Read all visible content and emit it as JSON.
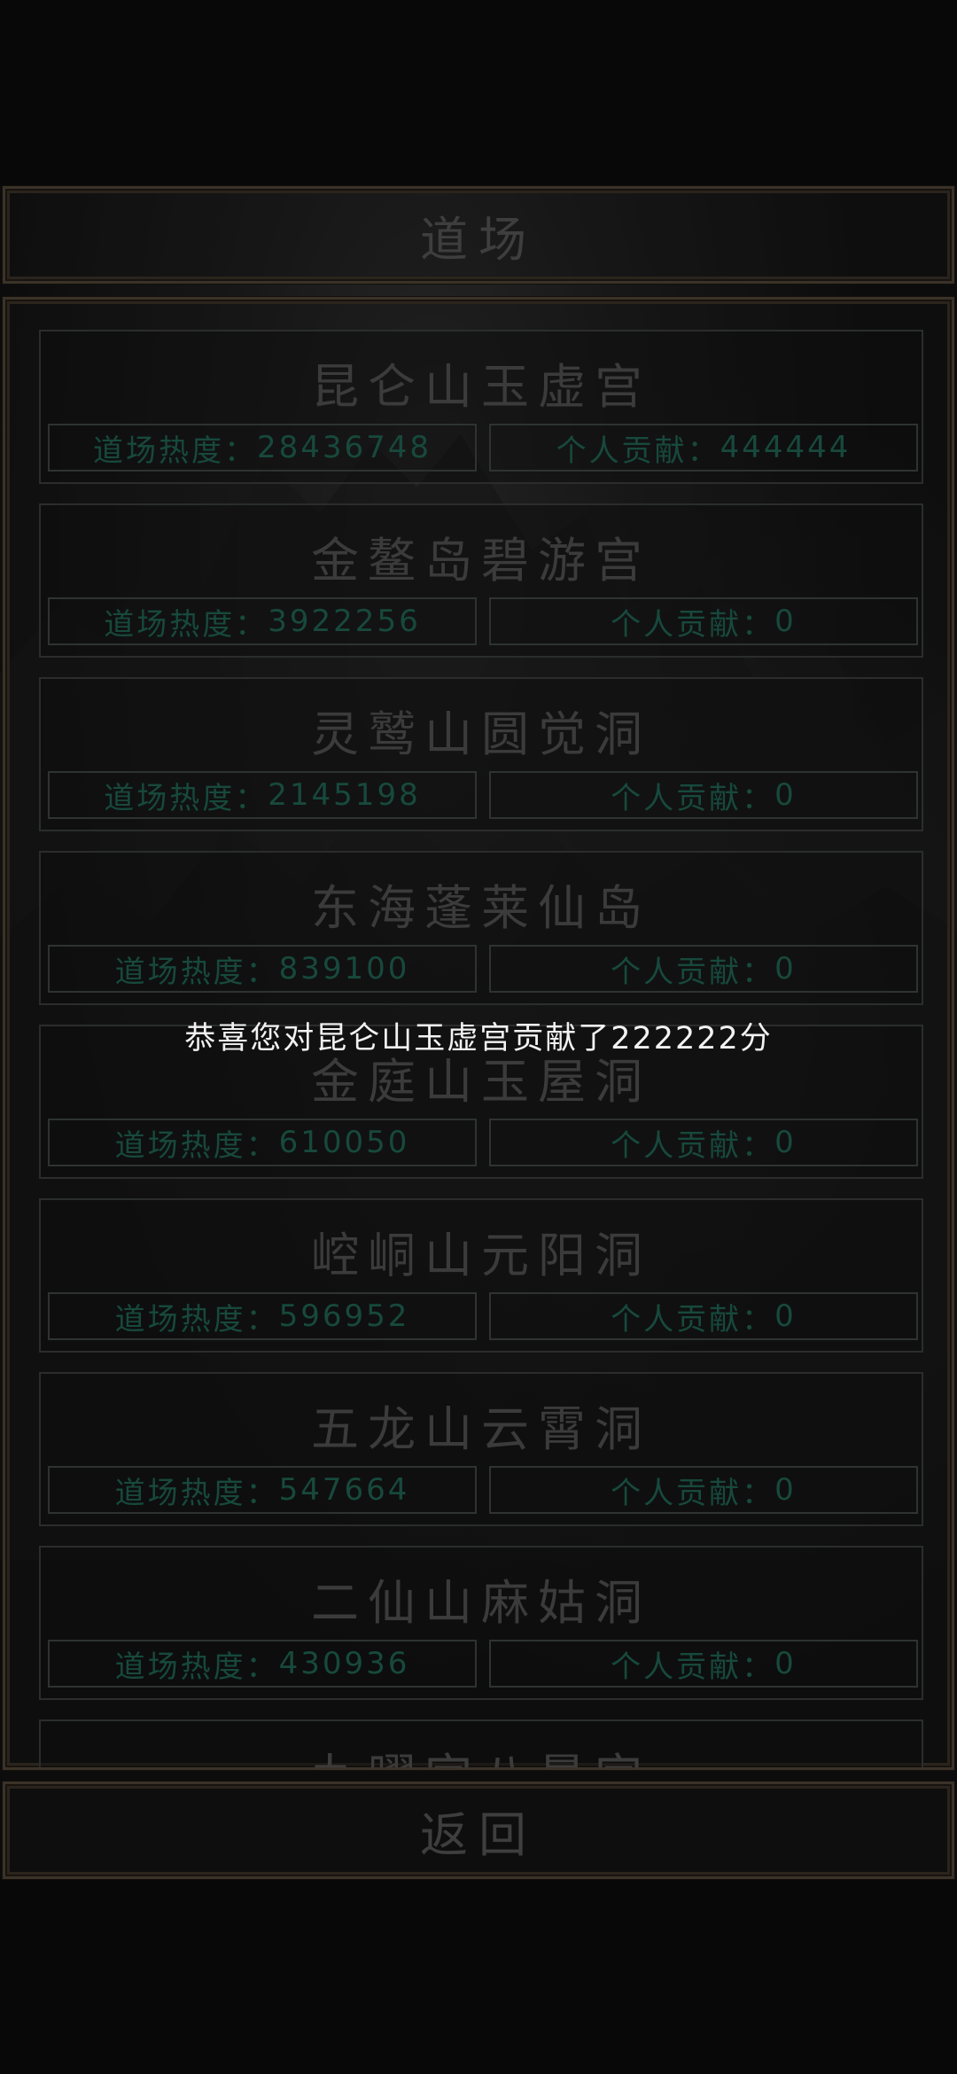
{
  "header": {
    "title": "道场"
  },
  "dojo_list": [
    {
      "name": "昆仑山玉虚宫",
      "heat_label": "道场热度：",
      "heat": "28436748",
      "contrib_label": "个人贡献：",
      "contrib": "444444"
    },
    {
      "name": "金鳌岛碧游宫",
      "heat_label": "道场热度：",
      "heat": "3922256",
      "contrib_label": "个人贡献：",
      "contrib": "0"
    },
    {
      "name": "灵鹫山圆觉洞",
      "heat_label": "道场热度：",
      "heat": "2145198",
      "contrib_label": "个人贡献：",
      "contrib": "0"
    },
    {
      "name": "东海蓬莱仙岛",
      "heat_label": "道场热度：",
      "heat": "839100",
      "contrib_label": "个人贡献：",
      "contrib": "0"
    },
    {
      "name": "金庭山玉屋洞",
      "heat_label": "道场热度：",
      "heat": "610050",
      "contrib_label": "个人贡献：",
      "contrib": "0"
    },
    {
      "name": "崆峒山元阳洞",
      "heat_label": "道场热度：",
      "heat": "596952",
      "contrib_label": "个人贡献：",
      "contrib": "0"
    },
    {
      "name": "五龙山云霄洞",
      "heat_label": "道场热度：",
      "heat": "547664",
      "contrib_label": "个人贡献：",
      "contrib": "0"
    },
    {
      "name": "二仙山麻姑洞",
      "heat_label": "道场热度：",
      "heat": "430936",
      "contrib_label": "个人贡献：",
      "contrib": "0"
    },
    {
      "name": "九曜宫八景宫",
      "heat_label": "",
      "heat": "",
      "contrib_label": "",
      "contrib": ""
    }
  ],
  "toast": {
    "message": "恭喜您对昆仑山玉虚宫贡献了222222分"
  },
  "footer": {
    "back_label": "返回"
  },
  "colors": {
    "background": "#080808",
    "frame_border": "#3a3228",
    "stat_text": "#17493c",
    "toast_text": "#f2f2f2"
  }
}
